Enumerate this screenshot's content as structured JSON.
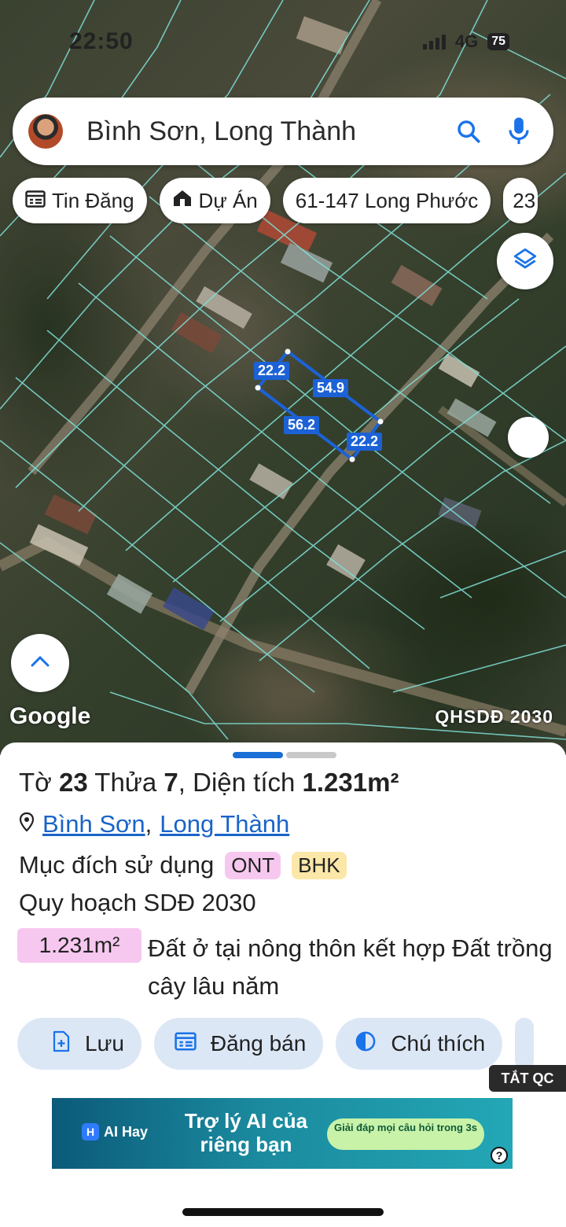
{
  "status_bar": {
    "time": "22:50",
    "network": "4G",
    "battery": "75"
  },
  "search": {
    "query": "Bình Sơn, Long Thành"
  },
  "chips": [
    {
      "label": "Tin Đăng",
      "icon": "listing-icon"
    },
    {
      "label": "Dự Án",
      "icon": "house-icon"
    },
    {
      "label": "61-147 Long Phước"
    },
    {
      "label": "23"
    }
  ],
  "map": {
    "attribution": "Google",
    "plan_layer": "QHSDĐ 2030",
    "edges": [
      "22.2",
      "54.9",
      "56.2",
      "22.2"
    ],
    "accent": "#1c62d6",
    "parcel_line_color": "#7fe0d8"
  },
  "parcel": {
    "prefix_sheet": "Tờ",
    "sheet": "23",
    "prefix_plot": "Thửa",
    "plot": "7",
    "area_label": ", Diện tích",
    "area": "1.231m²",
    "location_commune": "Bình Sơn",
    "location_sep": ",",
    "location_district": "Long Thành",
    "usage_label": "Mục đích sử dụng",
    "tags": [
      {
        "code": "ONT",
        "bg": "#f7c8ef"
      },
      {
        "code": "BHK",
        "bg": "#fbe7a8"
      }
    ],
    "plan_label": "Quy hoạch SDĐ 2030",
    "plan_area": "1.231m²",
    "plan_desc": "Đất ở tại nông thôn kết hợp Đất trồng cây lâu năm"
  },
  "actions": [
    {
      "label": "Lưu",
      "icon": "save-icon"
    },
    {
      "label": "Đăng bán",
      "icon": "post-icon"
    },
    {
      "label": "Chú thích",
      "icon": "legend-icon"
    }
  ],
  "ad": {
    "hide_label": "TẮT QC",
    "brand": "AI Hay",
    "brand_letter": "H",
    "headline": "Trợ lý AI của riêng bạn",
    "cta": "Giải đáp mọi câu hỏi trong 3s",
    "info": "?"
  },
  "sheet_handle_colors": [
    "#1a6fd6",
    "#c9c9c9"
  ]
}
